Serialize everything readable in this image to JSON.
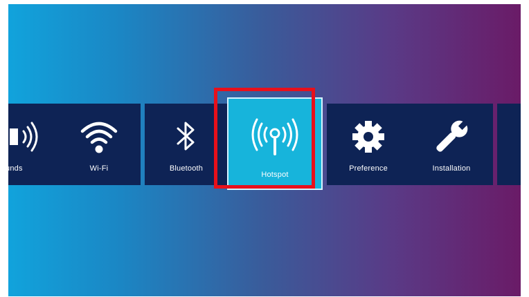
{
  "menu": {
    "items": [
      {
        "id": "sounds",
        "label": "unds",
        "icon": "speaker-icon"
      },
      {
        "id": "wifi",
        "label": "Wi-Fi",
        "icon": "wifi-icon"
      },
      {
        "id": "bluetooth",
        "label": "Bluetooth",
        "icon": "bluetooth-icon"
      },
      {
        "id": "hotspot",
        "label": "Hotspot",
        "icon": "hotspot-icon",
        "selected": true
      },
      {
        "id": "preference",
        "label": "Preference",
        "icon": "gear-icon"
      },
      {
        "id": "installation",
        "label": "Installation",
        "icon": "wrench-icon"
      },
      {
        "id": "next",
        "label": "",
        "icon": "circle-icon"
      }
    ]
  },
  "colors": {
    "tile_bg": "#0e2355",
    "tile_active_bg": "#17b4db",
    "focus_ring": "#e8101b",
    "gradient_left": "#11a3dc",
    "gradient_right": "#6a1b67"
  }
}
